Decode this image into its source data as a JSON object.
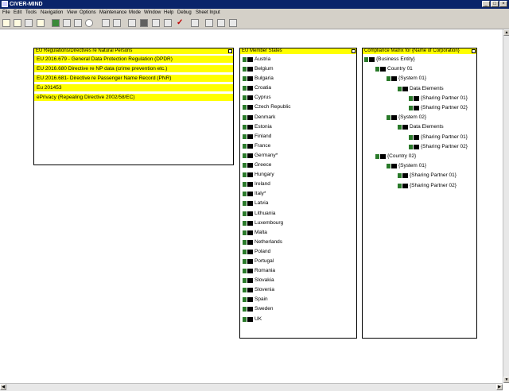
{
  "window": {
    "title": "CIVER-MIND",
    "controls": [
      "_",
      "□",
      "×"
    ]
  },
  "menubar": [
    "File",
    "Edit",
    "Tools",
    "Navigation",
    "View",
    "Options",
    "Maintenance",
    "Mode",
    "Window",
    "Help",
    "Debug",
    "Sheet Input"
  ],
  "toolbar_icons": [
    "new-doc-icon",
    "open-doc-icon",
    "copy-icon",
    "open-folder-icon",
    "green-square-icon",
    "page-icon",
    "tag-icon",
    "circle-icon",
    "pen-icon",
    "tools-icon",
    "wand-icon",
    "eye-icon",
    "zoom-in-icon",
    "zoom-out-icon",
    "check-icon",
    "puzzle-icon",
    "print-icon",
    "cross-tools-icon",
    "export-icon"
  ],
  "regulations_panel": {
    "title": "EU Regulations/Directives re Natural Persons",
    "items": [
      "EU 2016.679 - General Data Protection Regulation (DPDR)",
      "EU 2016.680 Directive re NP data (crime prevention etc.)",
      "EU 2016.681- Directive re Passenger Name Record (PNR)",
      "Eu 201453",
      "ePrivacy (Repealing Directive 2002/58/EC)"
    ]
  },
  "member_states_panel": {
    "title": "EU Member States",
    "items": [
      "Austria",
      "Belgium",
      "Bulgaria",
      "Croatia",
      "Cyprus",
      "Czech Republic",
      "Denmark",
      "Estonia",
      "Finland",
      "France",
      "Germany*",
      "Greece",
      "Hungary",
      "Ireland",
      "Italy*",
      "Latvia",
      "Lithuania",
      "Luxembourg",
      "Malta",
      "Netherlands",
      "Poland",
      "Portugal",
      "Romania",
      "Slovakia",
      "Slovenia",
      "Spain",
      "Sweden",
      "UK"
    ]
  },
  "compliance_panel": {
    "title": "Compliance Matrix for {Name of Corporation}",
    "tree": [
      {
        "label": "{Business Entity}",
        "level": 0
      },
      {
        "label": "Country 01",
        "level": 1
      },
      {
        "label": "{System 01}",
        "level": 2
      },
      {
        "label": "Data Elements",
        "level": 3
      },
      {
        "label": "{Sharing Partner 01}",
        "level": 4
      },
      {
        "label": "{Sharing Partner 02}",
        "level": 4
      },
      {
        "label": "{System 02}",
        "level": 2
      },
      {
        "label": "Data Elements",
        "level": 3
      },
      {
        "label": "{Sharing Partner 01}",
        "level": 4
      },
      {
        "label": "{Sharing Partner 02}",
        "level": 4
      },
      {
        "label": "{Country 02}",
        "level": 1
      },
      {
        "label": "{System 01}",
        "level": 2
      },
      {
        "label": "{Sharing Partner 01}",
        "level": 3
      },
      {
        "label": "{Sharing Partner 02}",
        "level": 3
      }
    ]
  }
}
